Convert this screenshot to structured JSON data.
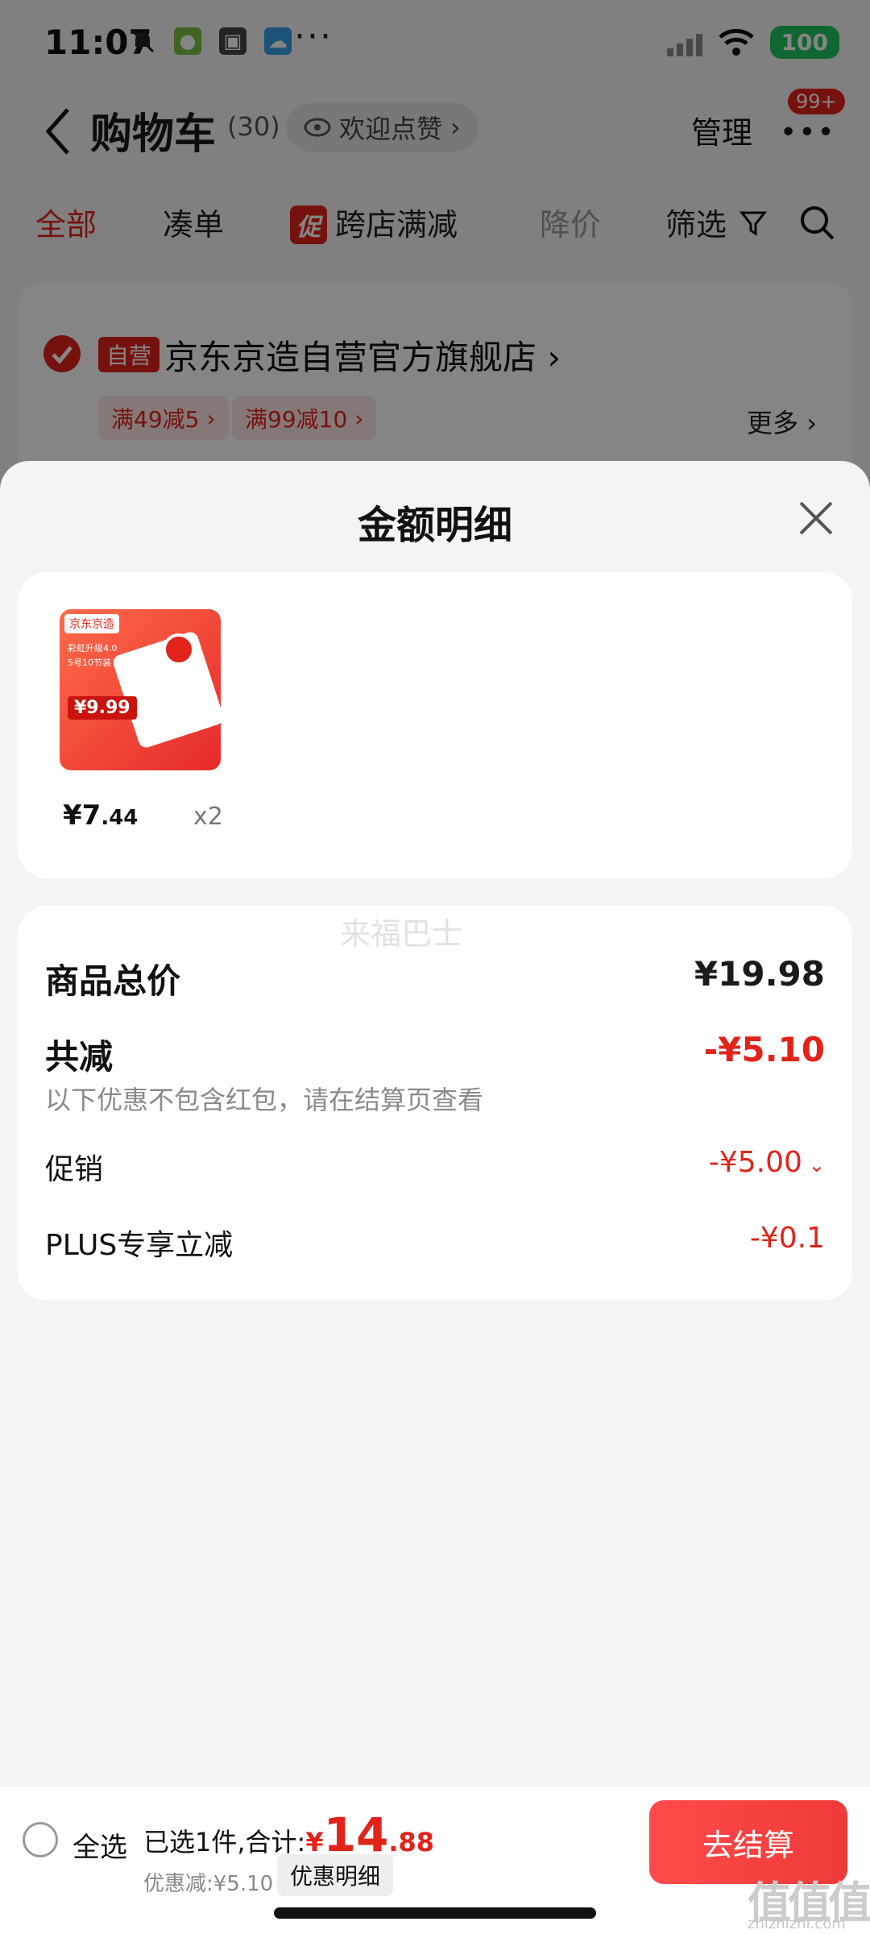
{
  "status_bar": {
    "time": "11:07",
    "dots": "···",
    "battery": "100"
  },
  "header": {
    "title": "购物车",
    "count": "(30)",
    "like_label": "欢迎点赞",
    "manage_label": "管理",
    "more_badge": "99+"
  },
  "filter_tabs": [
    {
      "label": "全部"
    },
    {
      "label": "凑单"
    },
    {
      "label": "跨店满减",
      "tag": "促"
    },
    {
      "label": "降价"
    },
    {
      "label": "筛选"
    }
  ],
  "store": {
    "tag": "自营",
    "name": "京东京造自营官方旗舰店",
    "coupons": [
      "满49减5",
      "满99减10"
    ],
    "more_label": "更多"
  },
  "sheet": {
    "title": "金额明细",
    "product": {
      "thumb": {
        "brand": "京东京造",
        "line1": "彩虹升级4.0",
        "line2": "5号10节装",
        "price": "¥9.99"
      },
      "price_int": "¥7",
      "price_dec": ".44",
      "quantity": "x2"
    },
    "watermark": "来福巴士",
    "rows": {
      "total_label": "商品总价",
      "total_value": "¥19.98",
      "reduce_label": "共减",
      "reduce_value": "-¥5.10",
      "reduce_note": "以下优惠不包含红包，请在结算页查看",
      "promo_label": "促销",
      "promo_value": "-¥5.00",
      "plus_label": "PLUS专享立减",
      "plus_value": "-¥0.1"
    }
  },
  "checkout": {
    "select_all": "全选",
    "summary_prefix": "已选1件,合计:",
    "currency": "¥",
    "total_int": "14",
    "total_dec": ".88",
    "discount": "优惠减:¥5.10",
    "detail_label": "优惠明细",
    "button": "去结算",
    "site_watermark": "值值值",
    "site_url": "zhizhizhi.com"
  },
  "colors": {
    "accent": "#e2231a",
    "battery": "#22c55e"
  }
}
